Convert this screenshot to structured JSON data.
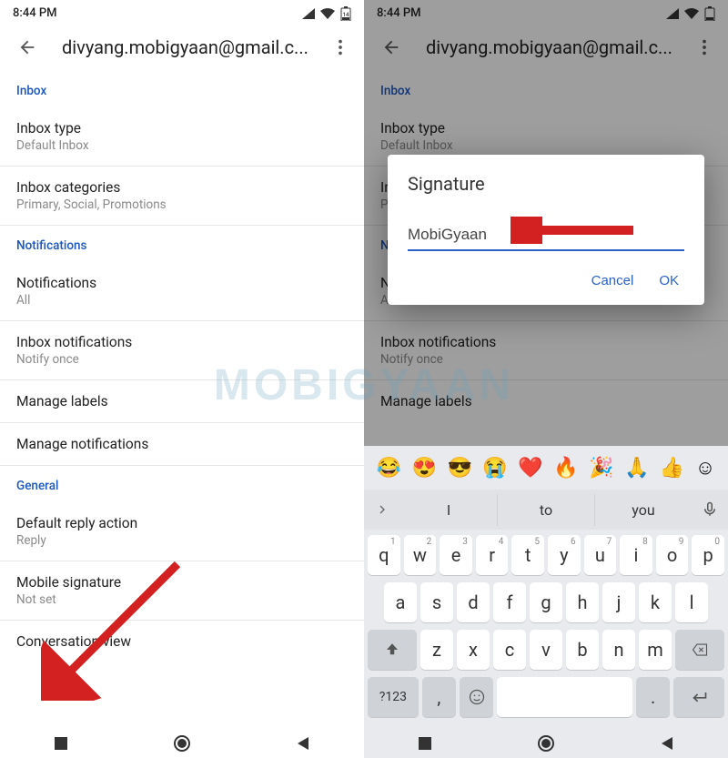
{
  "statusbar": {
    "time": "8:44 PM",
    "battery": "14"
  },
  "appbar": {
    "title": "divyang.mobigyaan@gmail.c..."
  },
  "sections": {
    "inbox_label": "Inbox",
    "notifications_label": "Notifications",
    "general_label": "General"
  },
  "items": {
    "inbox_type": {
      "primary": "Inbox type",
      "secondary": "Default Inbox"
    },
    "inbox_categories": {
      "primary": "Inbox categories",
      "secondary": "Primary, Social, Promotions"
    },
    "notifications": {
      "primary": "Notifications",
      "secondary": "All"
    },
    "inbox_notifications": {
      "primary": "Inbox notifications",
      "secondary": "Notify once"
    },
    "manage_labels": {
      "primary": "Manage labels"
    },
    "manage_notifications": {
      "primary": "Manage notifications"
    },
    "default_reply": {
      "primary": "Default reply action",
      "secondary": "Reply"
    },
    "mobile_signature": {
      "primary": "Mobile signature",
      "secondary": "Not set"
    },
    "conversation_view": {
      "primary": "Conversation view"
    }
  },
  "dialog": {
    "title": "Signature",
    "input_value": "MobiGyaan",
    "cancel": "Cancel",
    "ok": "OK"
  },
  "keyboard": {
    "emojis": [
      "😂",
      "😍",
      "😎",
      "😭",
      "❤️",
      "🔥",
      "🎉",
      "🙏",
      "👍",
      "☺"
    ],
    "suggestions": [
      "I",
      "to",
      "you"
    ],
    "row1": [
      {
        "k": "q",
        "s": "1"
      },
      {
        "k": "w",
        "s": "2"
      },
      {
        "k": "e",
        "s": "3"
      },
      {
        "k": "r",
        "s": "4"
      },
      {
        "k": "t",
        "s": "5"
      },
      {
        "k": "y",
        "s": "6"
      },
      {
        "k": "u",
        "s": "7"
      },
      {
        "k": "i",
        "s": "8"
      },
      {
        "k": "o",
        "s": "9"
      },
      {
        "k": "p",
        "s": "0"
      }
    ],
    "row2": [
      "a",
      "s",
      "d",
      "f",
      "g",
      "h",
      "j",
      "k",
      "l"
    ],
    "row3": [
      "z",
      "x",
      "c",
      "v",
      "b",
      "n",
      "m"
    ],
    "sym": "?123",
    "period": "."
  },
  "watermark": "MOBIGYAAN"
}
